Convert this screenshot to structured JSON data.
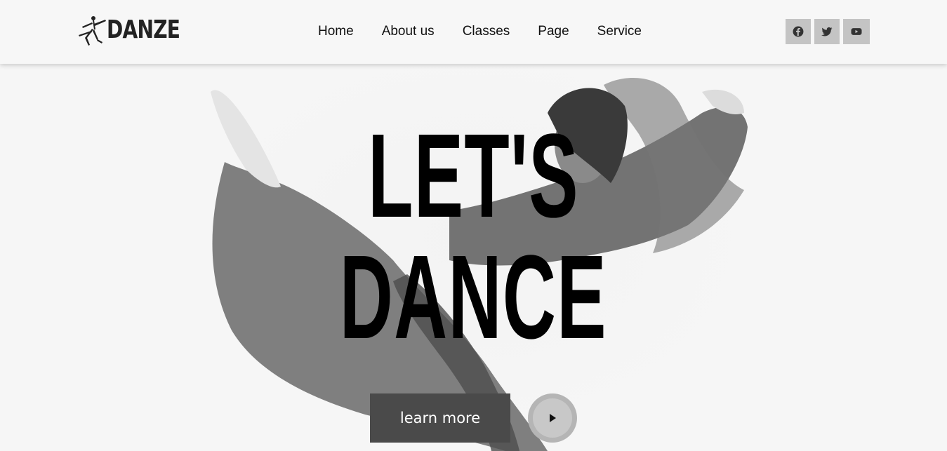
{
  "header": {
    "logo_text": "DANZE",
    "nav": [
      {
        "label": "Home"
      },
      {
        "label": "About us"
      },
      {
        "label": "Classes"
      },
      {
        "label": "Page"
      },
      {
        "label": "Service"
      }
    ],
    "socials": [
      {
        "icon": "facebook-icon"
      },
      {
        "icon": "twitter-icon"
      },
      {
        "icon": "youtube-icon"
      }
    ]
  },
  "hero": {
    "headline_line1": "LET'S",
    "headline_line2": "DANCE",
    "cta_label": "learn more",
    "play_icon": "play-icon"
  },
  "colors": {
    "background": "#f6f6f6",
    "button": "#4a4a4a",
    "social_bg": "#c4c4c4",
    "text": "#111111"
  }
}
